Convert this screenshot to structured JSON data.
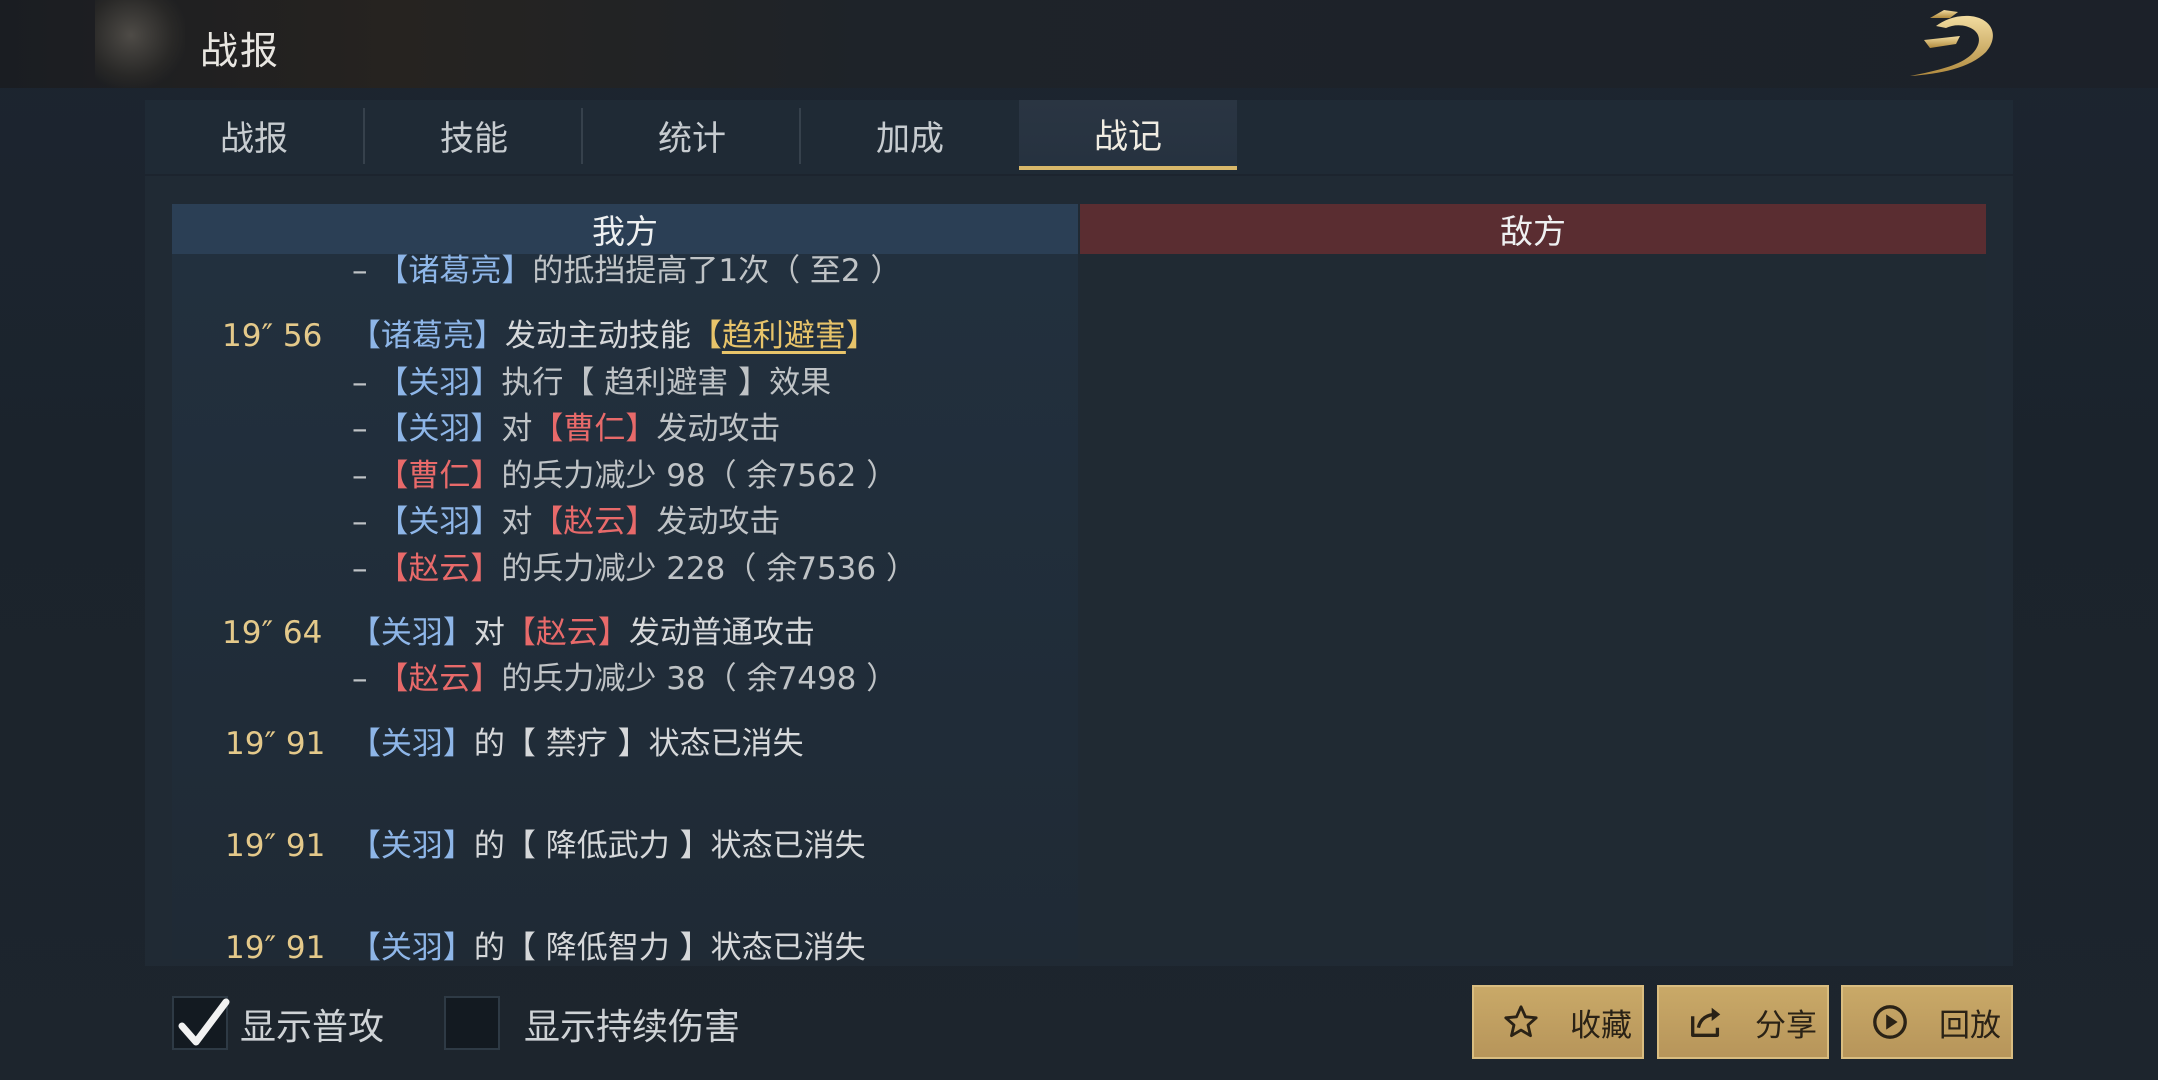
{
  "header": {
    "title": "战报"
  },
  "tabs": [
    {
      "label": "战报"
    },
    {
      "label": "技能"
    },
    {
      "label": "统计"
    },
    {
      "label": "加成"
    },
    {
      "label": "战记",
      "active": true
    }
  ],
  "columns": {
    "mine": "我方",
    "enemy": "敌方"
  },
  "log": {
    "l0": {
      "dash": "–",
      "b1": "【",
      "n1": "诸葛亮",
      "b2": "】",
      "t1": "的抵挡提高了1次（ 至2 ）"
    },
    "e1": {
      "time": "19″ 56",
      "b1": "【",
      "n1": "诸葛亮",
      "b2": "】",
      "t1": "发动主动技能",
      "b3": "【",
      "skill": "趋利避害",
      "b4": "】"
    },
    "e1s1": {
      "dash": "–",
      "b1": "【",
      "n1": "关羽",
      "b2": "】",
      "t1": "执行【 趋利避害 】效果"
    },
    "e1s2": {
      "dash": "–",
      "b1": "【",
      "n1": "关羽",
      "b2": "】",
      "t1": "对",
      "b3": "【",
      "n2": "曹仁",
      "b4": "】",
      "t2": "发动攻击"
    },
    "e1s3": {
      "dash": "–",
      "b1": "【",
      "n1": "曹仁",
      "b2": "】",
      "t1": "的兵力减少 98（ 余7562 ）"
    },
    "e1s4": {
      "dash": "–",
      "b1": "【",
      "n1": "关羽",
      "b2": "】",
      "t1": "对",
      "b3": "【",
      "n2": "赵云",
      "b4": "】",
      "t2": "发动攻击"
    },
    "e1s5": {
      "dash": "–",
      "b1": "【",
      "n1": "赵云",
      "b2": "】",
      "t1": "的兵力减少 228（ 余7536 ）"
    },
    "e2": {
      "time": "19″ 64",
      "b1": "【",
      "n1": "关羽",
      "b2": "】",
      "t1": "对",
      "b3": "【",
      "n2": "赵云",
      "b4": "】",
      "t2": "发动普通攻击"
    },
    "e2s1": {
      "dash": "–",
      "b1": "【",
      "n1": "赵云",
      "b2": "】",
      "t1": "的兵力减少 38（ 余7498 ）"
    },
    "e3": {
      "time": "19″ 91",
      "b1": "【",
      "n1": "关羽",
      "b2": "】",
      "t1": "的【 禁疗 】状态已消失"
    },
    "e4": {
      "time": "19″ 91",
      "b1": "【",
      "n1": "关羽",
      "b2": "】",
      "t1": "的【 降低武力 】状态已消失"
    },
    "e5": {
      "time": "19″ 91",
      "b1": "【",
      "n1": "关羽",
      "b2": "】",
      "t1": "的【 降低智力 】状态已消失"
    }
  },
  "options": {
    "show_normal_attack": {
      "label": "显示普攻",
      "checked": true
    },
    "show_dot": {
      "label": "显示持续伤害",
      "checked": false
    }
  },
  "buttons": {
    "favorite": {
      "label": "收藏",
      "icon": "star-icon"
    },
    "share": {
      "label": "分享",
      "icon": "share-icon"
    },
    "replay": {
      "label": "回放",
      "icon": "play-icon"
    }
  },
  "colors": {
    "ally_name": "#8eb6e8",
    "enemy_name": "#e86a6a",
    "time": "#e4c98a",
    "accent": "#d8b86a"
  }
}
